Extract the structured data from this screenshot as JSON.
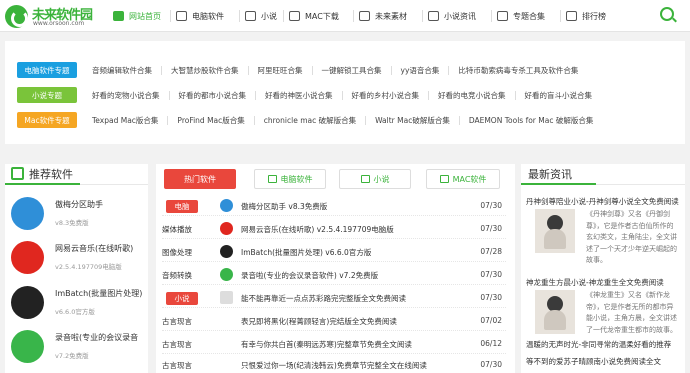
{
  "logo": {
    "title": "未来软件园",
    "url": "www.orsoon.com"
  },
  "nav": [
    {
      "label": "网站首页",
      "icon": "home-icon",
      "active": true
    },
    {
      "label": "电脑软件",
      "icon": "monitor-icon"
    },
    {
      "label": "小说",
      "icon": "pencil-icon"
    },
    {
      "label": "MAC下载",
      "icon": "mac-icon"
    },
    {
      "label": "未来素材",
      "icon": "image-icon"
    },
    {
      "label": "小说资讯",
      "icon": "book-icon"
    },
    {
      "label": "专题合集",
      "icon": "tag-icon"
    },
    {
      "label": "排行榜",
      "icon": "chart-icon"
    }
  ],
  "topics": [
    {
      "tag": "电脑软件专题",
      "color": "#1a9fe0",
      "links": [
        "音频编辑软件合集",
        "大智慧炒股软件合集",
        "阿里旺旺合集",
        "一键解锁工具合集",
        "yy语音合集",
        "比特币勒索病毒专杀工具及软件合集"
      ]
    },
    {
      "tag": "小说专题",
      "color": "#7ac43a",
      "links": [
        "好看的宠物小说合集",
        "好看的都市小说合集",
        "好看的神医小说合集",
        "好看的乡村小说合集",
        "好看的电竞小说合集",
        "好看的盲斗小说合集"
      ]
    },
    {
      "tag": "Mac软件专题",
      "color": "#f5a623",
      "links": [
        "Texpad Mac版合集",
        "ProFind Mac版合集",
        "chronicle mac 破解版合集",
        "Waltr Mac破解版合集",
        "DAEMON Tools for Mac 破解版合集"
      ]
    }
  ],
  "left_panel": {
    "title": "推荐软件",
    "apps": [
      {
        "name": "傲梅分区助手",
        "version": "v8.3免费版",
        "color": "#2f8fd8"
      },
      {
        "name": "网易云音乐(在线听歌)",
        "version": "v2.5.4.197709电脑版",
        "color": "#e0271f"
      },
      {
        "name": "ImBatch(批量图片处理)",
        "version": "v6.6.0官方版",
        "color": "#222222"
      },
      {
        "name": "录音啦(专业的会议录音",
        "version": "v7.2免费版",
        "color": "#39b54a"
      }
    ]
  },
  "center_panel": {
    "tabs": [
      {
        "label": "热门软件",
        "active": true
      },
      {
        "label": "电脑软件"
      },
      {
        "label": "小说"
      },
      {
        "label": "MAC软件"
      }
    ],
    "rows": [
      {
        "cat": "电脑",
        "cat_style": "red",
        "icon_color": "#2f8fd8",
        "title": "傲梅分区助手 v8.3免费版",
        "date": "07/30"
      },
      {
        "cat": "媒体播放",
        "cat_style": "plain",
        "icon_color": "#e0271f",
        "title": "网易云音乐(在线听歌) v2.5.4.197709电脑版",
        "date": "07/30"
      },
      {
        "cat": "图像处理",
        "cat_style": "plain",
        "icon_color": "#222222",
        "title": "ImBatch(批量图片处理) v6.6.0官方版",
        "date": "07/28"
      },
      {
        "cat": "音频转换",
        "cat_style": "plain",
        "icon_color": "#39b54a",
        "title": "录音啦(专业的会议录音软件) v7.2免费版",
        "date": "07/30"
      },
      {
        "cat": "小说",
        "cat_style": "red",
        "icon_color": "",
        "title": "能不能再靠近一点点苏彩路完完整版全文免费阅读",
        "date": "07/30"
      },
      {
        "cat": "古言现言",
        "cat_style": "plain",
        "icon_color": "",
        "title": "表兄即将黑化(程菁顾轻言)完结版全文免费阅读",
        "date": "07/02"
      },
      {
        "cat": "古言现言",
        "cat_style": "plain",
        "icon_color": "",
        "title": "有幸与你共白首(秦明远苏寒)完整章节免费全文阅读",
        "date": "06/12"
      },
      {
        "cat": "古言现言",
        "cat_style": "plain",
        "icon_color": "",
        "title": "只恨爱过你一场(纪清浅韩云)免费章节完整全文在线阅读",
        "date": "07/30"
      }
    ]
  },
  "right_panel": {
    "title": "最新资讯",
    "news": [
      {
        "headline": "丹神剑尊陪业小说-丹神剑尊小说全文免费阅读",
        "desc": "《丹神剑尊》又名《丹御剑尊》，它是作者古伯仙所作的玄幻类文，主角陆尘，全文讲述了一个天才少年逆天崛起的故事。"
      },
      {
        "headline": "神龙重生方晨小说-神龙重生全文免费阅读",
        "desc": "《神龙重生》又名《新作龙帝》，它是作者无所的都市异能小说，主角方晨，全文讲述了一代龙帝重生都市的故事。"
      }
    ],
    "lines": [
      "温暖的无声时光-非同寻常的温柔好看的推荐",
      "等不到的爱苏子晴顾南小说免费阅读全文"
    ]
  }
}
